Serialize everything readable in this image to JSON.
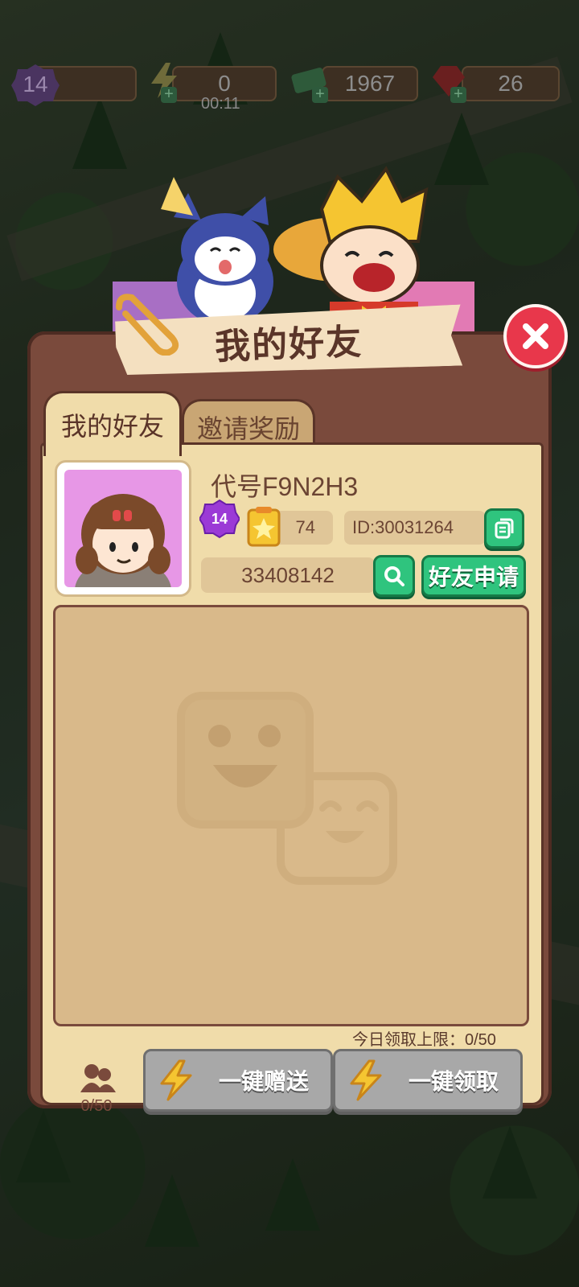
{
  "hud": {
    "level": "14",
    "energy": "0",
    "energy_timer": "00:11",
    "cash": "1967",
    "gems": "26"
  },
  "dialog": {
    "title": "我的好友",
    "tabs": [
      {
        "label": "我的好友",
        "active": true
      },
      {
        "label": "邀请奖励",
        "active": false
      }
    ]
  },
  "profile": {
    "name": "代号F9N2H3",
    "level": "14",
    "stars": "74",
    "id": "ID:30031264",
    "search_value": "33408142",
    "apply_label": "好友申请"
  },
  "friends": {
    "daily_limit": "今日领取上限：0/50",
    "count": "0/50",
    "send_all_label": "一键赠送",
    "claim_all_label": "一键领取"
  },
  "colors": {
    "panel": "#7a4a3c",
    "parchment": "#f0dcaa",
    "green_button": "#2fc47e",
    "close_red": "#e8374b",
    "disabled_gray": "#a8a8a8"
  }
}
